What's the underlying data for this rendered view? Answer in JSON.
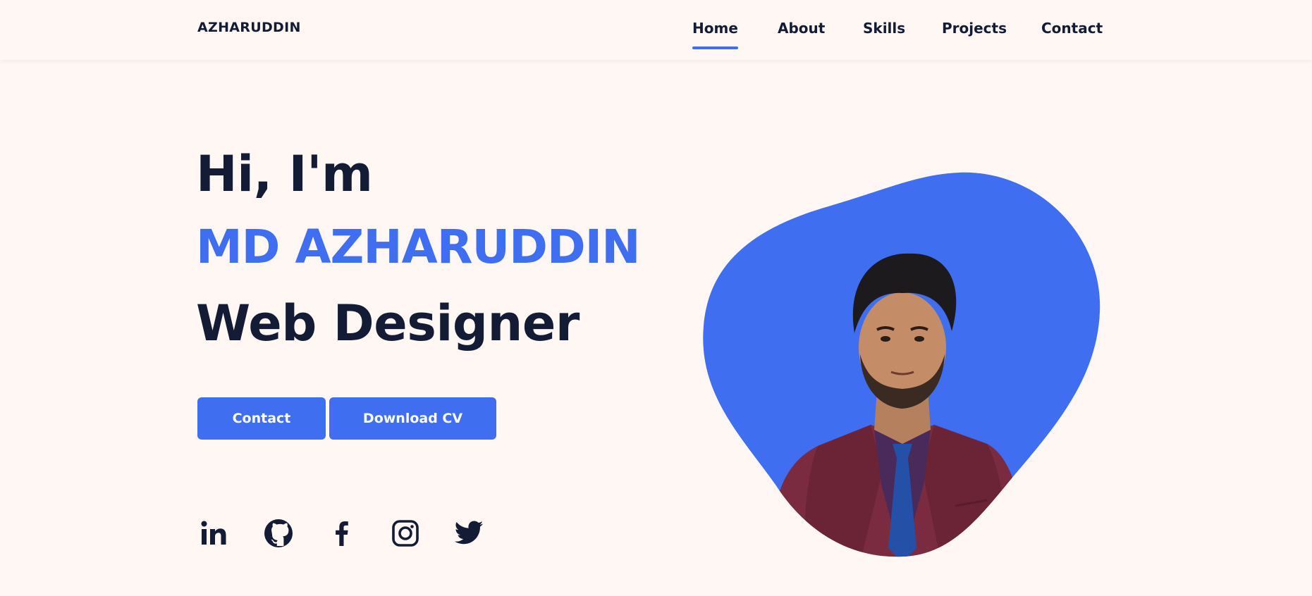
{
  "header": {
    "logo": "AZHARUDDIN",
    "nav": [
      {
        "label": "Home",
        "active": true
      },
      {
        "label": "About",
        "active": false
      },
      {
        "label": "Skills",
        "active": false
      },
      {
        "label": "Projects",
        "active": false
      },
      {
        "label": "Contact",
        "active": false
      }
    ]
  },
  "hero": {
    "greeting": "Hi, I'm",
    "name": "MD AZHARUDDIN",
    "role": "Web Designer",
    "buttons": {
      "contact": "Contact",
      "download_cv": "Download CV"
    }
  },
  "social_icons": [
    "linkedin-icon",
    "github-icon",
    "facebook-icon",
    "instagram-icon",
    "twitter-icon"
  ],
  "colors": {
    "background": "#fff7f3",
    "accent": "#3f6ef1",
    "text": "#141b34",
    "button_text": "#ffffff"
  }
}
